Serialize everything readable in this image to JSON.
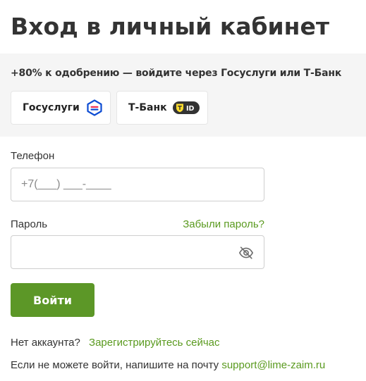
{
  "page": {
    "title": "Вход в личный кабинет"
  },
  "promo": {
    "text": "+80% к одобрению — войдите через Госуслуги или Т-Банк",
    "gosuslugi_label": "Госуслуги",
    "tbank_label": "Т-Банк",
    "tbank_badge": "ID"
  },
  "form": {
    "phone_label": "Телефон",
    "phone_placeholder": "+7(___) ___-____",
    "password_label": "Пароль",
    "password_value": "",
    "forgot_label": "Забыли пароль?",
    "submit_label": "Войти"
  },
  "footer": {
    "no_account": "Нет аккаунта?",
    "register_link": "Зарегистрируйтесь сейчас",
    "help_text": "Если не можете войти, напишите на почту",
    "email_link": "support@lime-zaim.ru"
  },
  "colors": {
    "accent_green": "#5c9727",
    "link_green": "#5a9a1f",
    "panel_bg": "#f5f5f5",
    "gosuslugi_blue": "#0d4cd3",
    "gosuslugi_red": "#ee2f53",
    "tbank_yellow": "#ffdd2d"
  },
  "icons": {
    "gosuslugi": "gosuslugi-logo-icon",
    "tbank": "tbank-id-icon",
    "password_visibility": "eye-off-icon"
  }
}
